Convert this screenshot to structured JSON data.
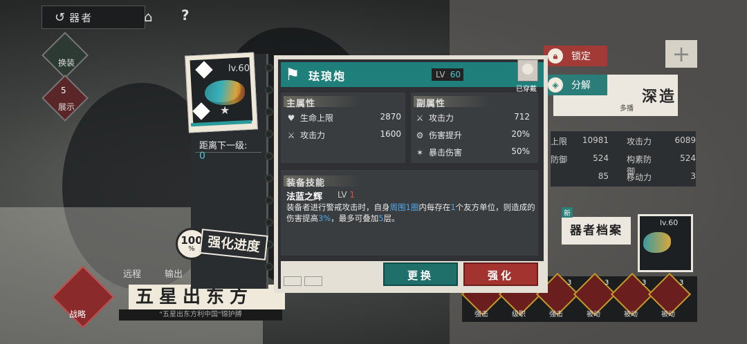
{
  "nav": {
    "back_icon": "back-arrow-icon",
    "title": "器者",
    "home_icon": "home-icon",
    "help_label": "?"
  },
  "sidebar": {
    "swap_label": "换装",
    "display_label": "展示",
    "display_count": "5"
  },
  "bottom_left": {
    "tags": [
      "远程",
      "输出"
    ],
    "title": "五星出东方",
    "subtitle": "\"五星出东方利中国\"锦护膊",
    "strategy_label": "战略"
  },
  "right_actions": {
    "lock_label": "锁定",
    "dismantle_label": "分解",
    "plus_label": "+"
  },
  "right_bg": {
    "deep_label": "深造",
    "deep_sub": "多播",
    "stats": [
      {
        "left_label": "上限",
        "left_value": "10981",
        "right_label": "攻击力",
        "right_value": "6089"
      },
      {
        "left_label": "防御",
        "left_value": "524",
        "right_label": "构素防御",
        "right_value": "524"
      },
      {
        "left_label": "",
        "left_value": "85",
        "right_label": "移动力",
        "right_value": "3"
      }
    ],
    "archive_tag": "新",
    "archive_label": "器者档案",
    "card_level": "lv.60",
    "skills": [
      {
        "label": "强击",
        "count": "3"
      },
      {
        "label": "级职",
        "count": "3"
      },
      {
        "label": "强击",
        "count": "3"
      },
      {
        "label": "被动",
        "count": "3"
      },
      {
        "label": "被动",
        "count": "3"
      },
      {
        "label": "被动",
        "count": "3"
      }
    ]
  },
  "item_card": {
    "level": "lv.60",
    "next_level_label": "距离下一级:",
    "next_level_value": "0",
    "progress_value": "100",
    "progress_unit": "%",
    "progress_label": "强化进度"
  },
  "detail": {
    "name": "珐琅炮",
    "level_prefix": "LV",
    "level_value": "60",
    "equipped_label": "已穿戴",
    "main_attr_title": "主属性",
    "sub_attr_title": "副属性",
    "main_attrs": [
      {
        "icon": "heart-icon",
        "label": "生命上限",
        "value": "2870"
      },
      {
        "icon": "crossed-swords-icon",
        "label": "攻击力",
        "value": "1600"
      }
    ],
    "sub_attrs": [
      {
        "icon": "crossed-swords-icon",
        "label": "攻击力",
        "value": "712"
      },
      {
        "icon": "gear-damage-icon",
        "label": "伤害提升",
        "value": "20%"
      },
      {
        "icon": "crit-icon",
        "label": "暴击伤害",
        "value": "50%"
      }
    ],
    "skill_title": "装备技能",
    "skill_name": "法蓝之辉",
    "skill_lv_prefix": "LV",
    "skill_lv_value": "1",
    "skill_desc_1": "装备者进行警戒攻击时，自身",
    "skill_desc_h1": "周围1圈",
    "skill_desc_2": "内每存在",
    "skill_desc_h2": "1",
    "skill_desc_3": "个友方单位，则造成的伤害提高",
    "skill_desc_h3": "3%",
    "skill_desc_4": "，最多可叠加",
    "skill_desc_h4": "5",
    "skill_desc_5": "层。",
    "change_label": "更换",
    "enhance_label": "强化"
  },
  "colors": {
    "teal": "#1f7f7b",
    "red": "#a3332e",
    "highlight_blue": "#4fa8e8",
    "cyan": "#4fc6d8"
  }
}
